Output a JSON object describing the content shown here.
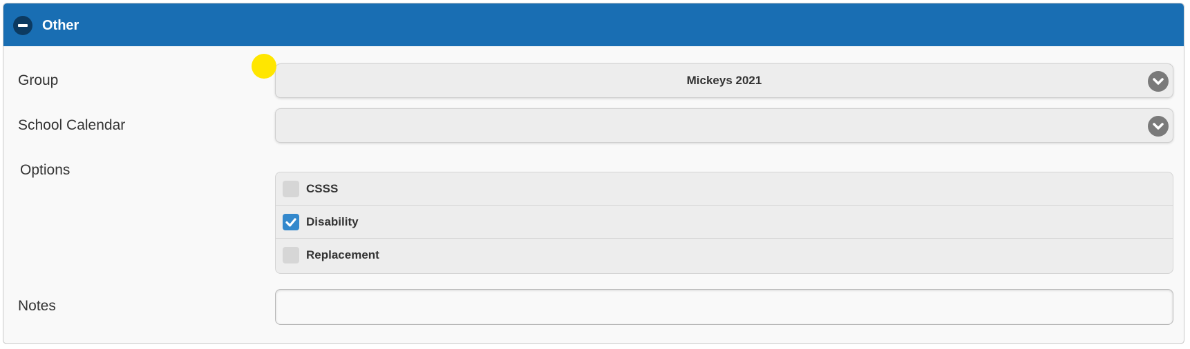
{
  "panel": {
    "title": "Other",
    "collapse_icon": "minus-circle-icon"
  },
  "form": {
    "group": {
      "label": "Group",
      "value": "Mickeys 2021"
    },
    "school_calendar": {
      "label": "School Calendar",
      "value": ""
    },
    "options": {
      "label": "Options",
      "items": [
        {
          "label": "CSSS",
          "checked": false
        },
        {
          "label": "Disability",
          "checked": true
        },
        {
          "label": "Replacement",
          "checked": false
        }
      ]
    },
    "notes": {
      "label": "Notes",
      "value": ""
    }
  },
  "colors": {
    "header_bg": "#196eb3",
    "checkbox_checked": "#3388cc",
    "cursor_highlight": "#ffe600"
  }
}
